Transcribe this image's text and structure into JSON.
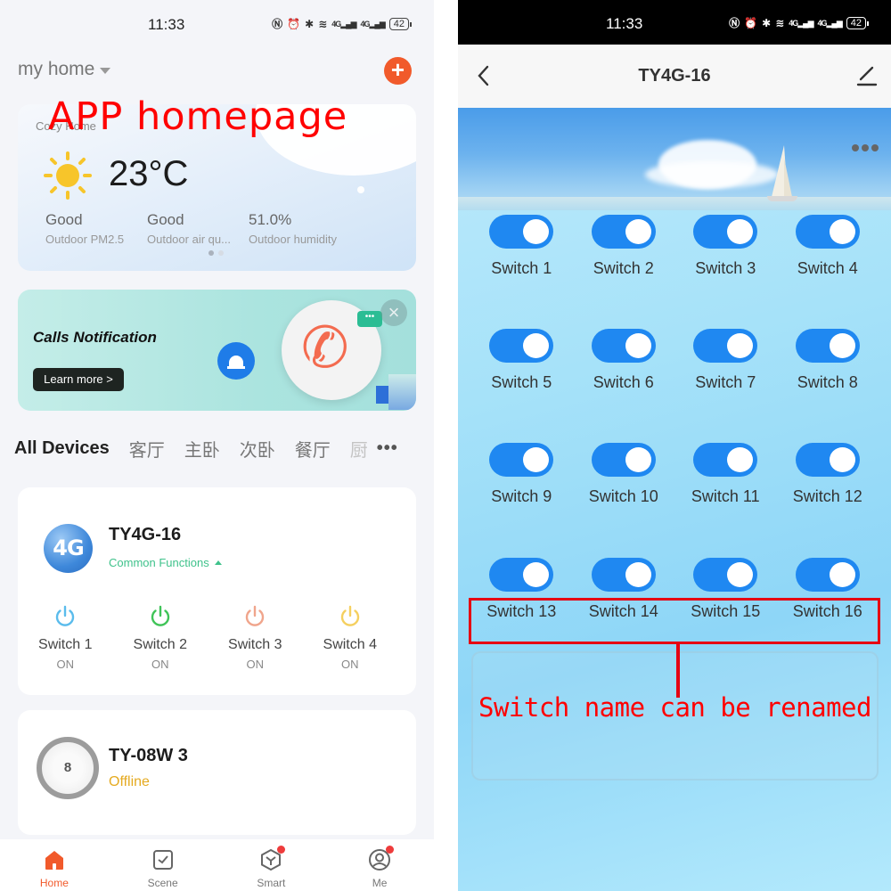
{
  "colors": {
    "accent_orange": "#f15a2b",
    "toggle_blue": "#1f88f1",
    "common_functions_green": "#3fc28b",
    "offline_amber": "#e5aa20",
    "annotation_red": "#ff0000",
    "power_icon_colors": [
      "#5bbcec",
      "#40c458",
      "#f0a58c",
      "#f5d060"
    ]
  },
  "annotations": {
    "left_title": "APP homepage",
    "right_callout": "Switch name can be renamed"
  },
  "left_screen": {
    "status_bar": {
      "time": "11:33",
      "icons": [
        "nfc-icon",
        "alarm-icon",
        "bluetooth-icon",
        "wifi-icon",
        "signal-4g-icon",
        "signal-4g-icon"
      ],
      "signal_label": "4G",
      "battery": "42"
    },
    "home_selector": "my home",
    "add_button": "+",
    "weather": {
      "location_label": "Cozy Home",
      "temperature": "23°C",
      "metrics": [
        {
          "value": "Good",
          "label": "Outdoor PM2.5"
        },
        {
          "value": "Good",
          "label": "Outdoor air qu..."
        },
        {
          "value": "51.0%",
          "label": "Outdoor humidity"
        }
      ],
      "pager_total": 2,
      "pager_active": 1
    },
    "banner": {
      "title": "Calls Notification",
      "button": "Learn more >",
      "close": "×",
      "chat_dots": "•••"
    },
    "room_tabs": {
      "items": [
        "All Devices",
        "客厅",
        "主卧",
        "次卧",
        "餐厅",
        "厨"
      ],
      "active": "All Devices",
      "more": "•••"
    },
    "devices": [
      {
        "name": "TY4G-16",
        "icon_text": "4G",
        "subtitle": "Common Functions",
        "switches": [
          {
            "name": "Switch 1",
            "state": "ON"
          },
          {
            "name": "Switch 2",
            "state": "ON"
          },
          {
            "name": "Switch 3",
            "state": "ON"
          },
          {
            "name": "Switch 4",
            "state": "ON"
          }
        ]
      },
      {
        "name": "TY-08W 3",
        "icon_text": "8",
        "status": "Offline"
      }
    ],
    "bottom_nav": [
      {
        "label": "Home",
        "active": true,
        "badge": false
      },
      {
        "label": "Scene",
        "active": false,
        "badge": false
      },
      {
        "label": "Smart",
        "active": false,
        "badge": true
      },
      {
        "label": "Me",
        "active": false,
        "badge": true
      }
    ]
  },
  "right_screen": {
    "status_bar": {
      "time": "11:33",
      "signal_label": "4G",
      "battery": "42"
    },
    "header": {
      "back": "<",
      "title": "TY4G-16"
    },
    "switches": [
      {
        "name": "Switch 1",
        "on": true
      },
      {
        "name": "Switch 2",
        "on": true
      },
      {
        "name": "Switch 3",
        "on": true
      },
      {
        "name": "Switch 4",
        "on": true
      },
      {
        "name": "Switch 5",
        "on": true
      },
      {
        "name": "Switch 6",
        "on": true
      },
      {
        "name": "Switch 7",
        "on": true
      },
      {
        "name": "Switch 8",
        "on": true
      },
      {
        "name": "Switch 9",
        "on": true
      },
      {
        "name": "Switch 10",
        "on": true
      },
      {
        "name": "Switch 11",
        "on": true
      },
      {
        "name": "Switch 12",
        "on": true
      },
      {
        "name": "Switch 13",
        "on": true
      },
      {
        "name": "Switch 14",
        "on": true
      },
      {
        "name": "Switch 15",
        "on": true
      },
      {
        "name": "Switch 16",
        "on": true
      }
    ]
  }
}
